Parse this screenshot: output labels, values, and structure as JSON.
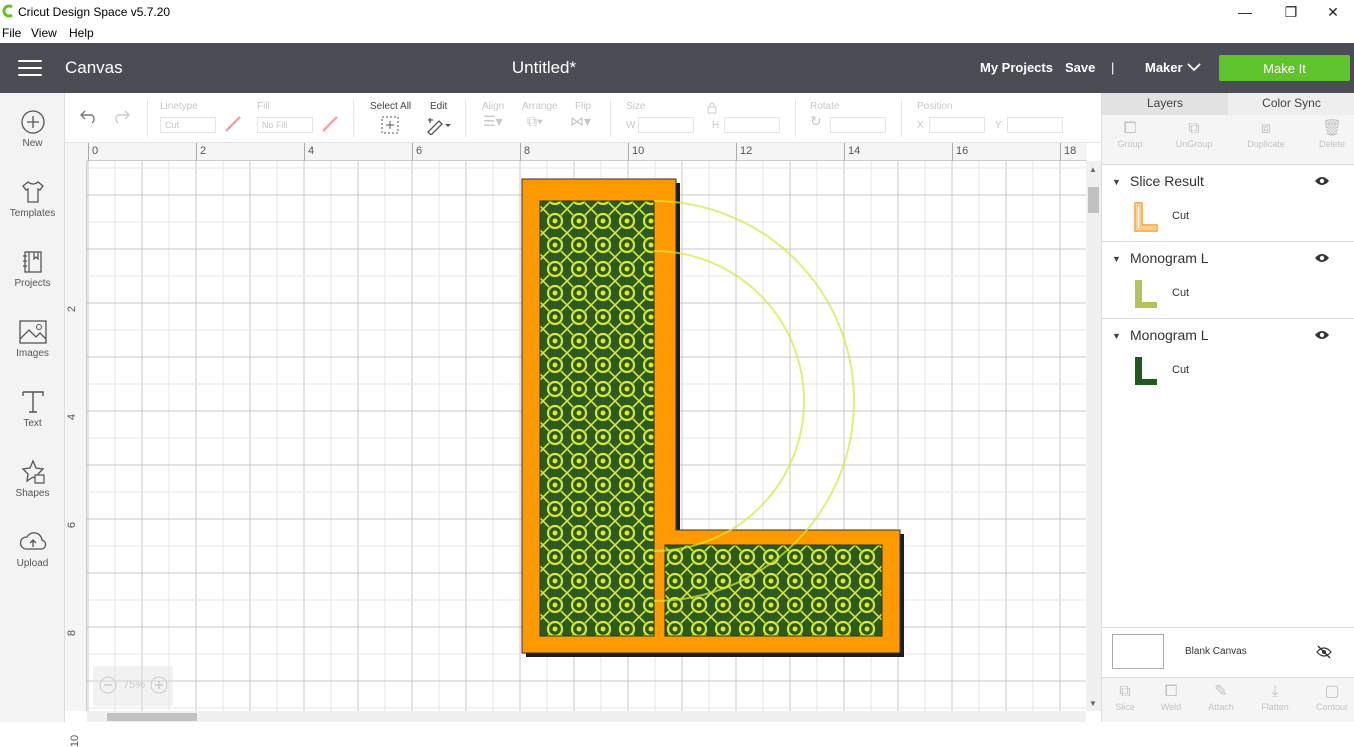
{
  "titlebar": {
    "title": "Cricut Design Space  v5.7.20",
    "minimize": "—",
    "restore": "❐",
    "close": "✕"
  },
  "menubar": {
    "items": [
      "File",
      "View",
      "Help"
    ]
  },
  "header": {
    "section": "Canvas",
    "doc_title": "Untitled*",
    "my_projects": "My Projects",
    "save": "Save",
    "separator": "|",
    "machine": "Maker",
    "make_it": "Make It",
    "accent_color": "#5fc42b"
  },
  "sidebar": {
    "items": [
      {
        "label": "New",
        "icon": "plus-circle-icon"
      },
      {
        "label": "Templates",
        "icon": "tshirt-icon"
      },
      {
        "label": "Projects",
        "icon": "projects-icon"
      },
      {
        "label": "Images",
        "icon": "image-icon"
      },
      {
        "label": "Text",
        "icon": "text-icon"
      },
      {
        "label": "Shapes",
        "icon": "shapes-icon"
      },
      {
        "label": "Upload",
        "icon": "upload-icon"
      }
    ]
  },
  "toolbar": {
    "linetype_label": "Linetype",
    "linetype_value": "Cut",
    "fill_label": "Fill",
    "fill_value": "No Fill",
    "select_all": "Select All",
    "edit": "Edit",
    "align": "Align",
    "arrange": "Arrange",
    "flip": "Flip",
    "size": "Size",
    "w": "W",
    "h": "H",
    "rotate": "Rotate",
    "position": "Position",
    "x": "X",
    "y": "Y"
  },
  "rulers": {
    "h": [
      "0",
      "2",
      "4",
      "6",
      "8",
      "10",
      "12",
      "14",
      "16",
      "18"
    ],
    "v": [
      "2",
      "4",
      "6",
      "8",
      "10"
    ]
  },
  "canvas": {
    "zoom": "75%",
    "letter_colors": {
      "outline": "#ff9900",
      "fill": "#d6e83a",
      "pattern": "#2d5a1e"
    }
  },
  "right_panel": {
    "tabs": [
      "Layers",
      "Color Sync"
    ],
    "tools": [
      "Group",
      "UnGroup",
      "Duplicate",
      "Delete"
    ],
    "layers": [
      {
        "name": "Slice Result",
        "operation": "Cut",
        "color": "#f59f2a"
      },
      {
        "name": "Monogram L",
        "operation": "Cut",
        "color": "#b7c25a"
      },
      {
        "name": "Monogram L",
        "operation": "Cut",
        "color": "#1f5a1f"
      }
    ],
    "blank_canvas": "Blank Canvas",
    "bottom_tools": [
      "Slice",
      "Weld",
      "Attach",
      "Flatten",
      "Contour"
    ]
  }
}
